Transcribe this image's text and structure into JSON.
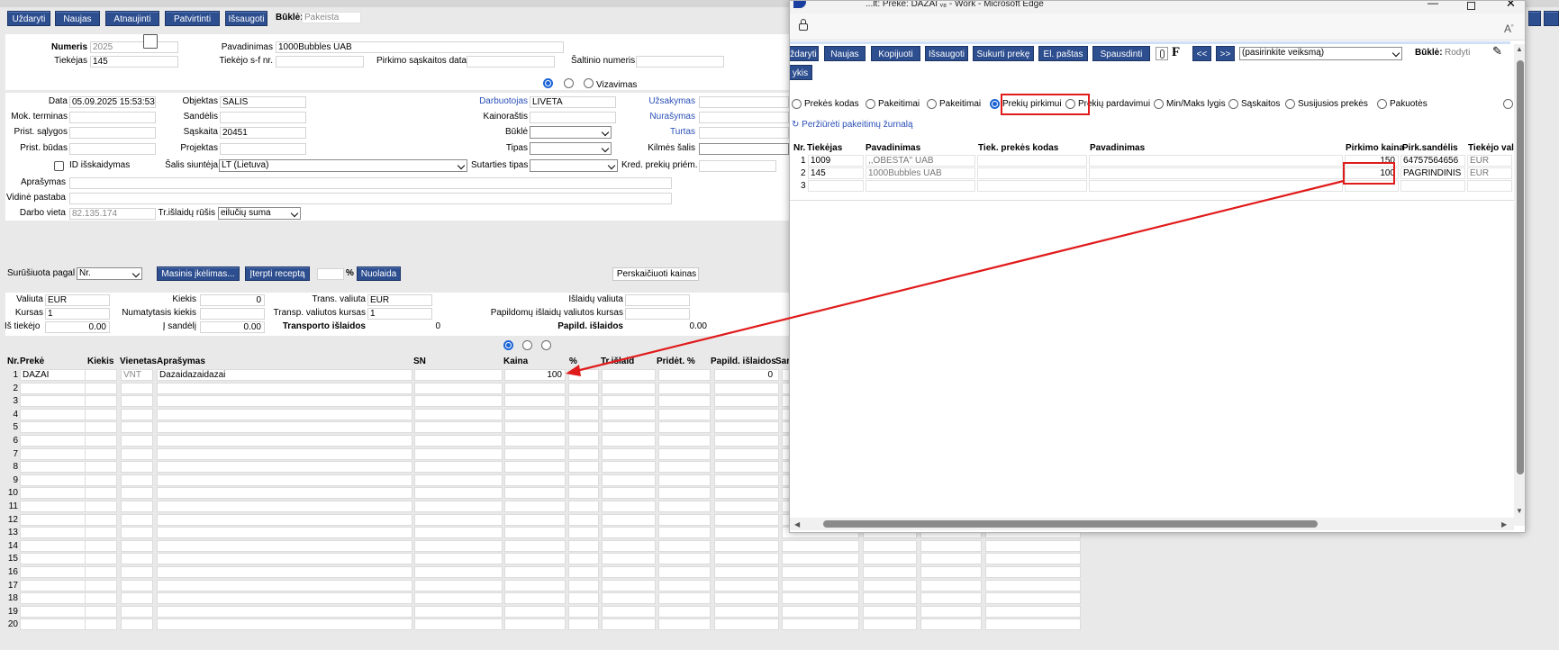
{
  "toolbar": {
    "buttons": [
      "Uždaryti",
      "Naujas",
      "Atnaujinti",
      "Patvirtinti",
      "Išsaugoti"
    ],
    "status_label": "Būklė:",
    "status_value": "Pakeista"
  },
  "header": {
    "numeris_label": "Numeris",
    "numeris": "2025",
    "tiekejas_label": "Tiekėjas",
    "tiekejas": "145",
    "pavadinimas_label": "Pavadinimas",
    "pavadinimas": "1000Bubbles UAB",
    "sf_label": "Tiekėjo s-f nr.",
    "pirkimo_label": "Pirkimo sąskaitos data",
    "saltinio_label": "Šaltinio numeris",
    "vizavimas_label": "Vizavimas"
  },
  "form": {
    "data_label": "Data",
    "data": "05.09.2025 15:53:53",
    "mok_label": "Mok. terminas",
    "prist_salygos_label": "Prist. sąlygos",
    "prist_budas_label": "Prist. būdas",
    "id_label": "ID išskaidymas",
    "objektas_label": "Objektas",
    "objektas": "ŠALIS",
    "sandelis_label": "Sandėlis",
    "saskaita_label": "Sąskaita",
    "saskaita": "20451",
    "projektas_label": "Projektas",
    "salis_label": "Šalis siuntėja",
    "salis": "LT (Lietuva)",
    "darbuotojas_label": "Darbuotojas",
    "darbuotojas": "LIVETA",
    "kainorastis_label": "Kainoraštis",
    "bukle_label": "Būklė",
    "tipas_label": "Tipas",
    "sutarties_label": "Sutarties tipas",
    "uzsakymas_label": "Užsakymas",
    "nurasymas_label": "Nurašymas",
    "turtas_label": "Turtas",
    "kilmes_label": "Kilmės šalis",
    "kred_label": "Kred. prekių priém.",
    "aprasymas_label": "Aprašymas",
    "vidine_label": "Vidinė pastaba",
    "darbo_label": "Darbo vieta",
    "darbo": "82.135.174",
    "trisl_label": "Tr.išlaidų rūšis",
    "trisl": "eilučių suma"
  },
  "sort": {
    "label": "Surūšiuota pagal",
    "value": "Nr.",
    "masinis": "Masinis įkėlimas...",
    "iterpti": "Įterpti receptą",
    "pct": "%",
    "nuolaida": "Nuolaida",
    "perskaiciuoti": "Perskaičiuoti kainas"
  },
  "totals": {
    "valiuta_label": "Valiuta",
    "valiuta": "EUR",
    "kursas_label": "Kursas",
    "kursas": "1",
    "is_tiekejo_label": "Iš tiekėjo",
    "is_tiekejo": "0.00",
    "kiekis_label": "Kiekis",
    "kiekis": "0",
    "numatytasis_label": "Numatytasis kiekis",
    "i_sandeli_label": "Į sandėlį",
    "i_sandeli": "0.00",
    "trans_val_label": "Trans. valiuta",
    "trans_val": "EUR",
    "transp_kursas_label": "Transp. valiutos kursas",
    "transp_kursas": "1",
    "transporto_label": "Transporto išlaidos",
    "transporto": "0",
    "islaidu_val_label": "Išlaidų valiuta",
    "papild_kursas_label": "Papildomų išlaidų valiutos kursas",
    "papild_label": "Papild. išlaidos",
    "papild": "0.00"
  },
  "grid": {
    "headers": [
      "Nr.",
      "Prekė",
      "Kiekis",
      "Vienetas",
      "Aprašymas",
      "SN",
      "Kaina",
      "%",
      "Tr.išlaid",
      "Pridėt. %",
      "Papild. išlaidos",
      "Sar"
    ],
    "row1": {
      "nr": "1",
      "preke": "DAZAI",
      "vienetas": "VNT",
      "aprasymas": "Dazaidazaidazai",
      "kaina": "100",
      "papild": "0"
    },
    "row_numbers": [
      "2",
      "3",
      "4",
      "5",
      "6",
      "7",
      "8",
      "9",
      "10",
      "11",
      "12",
      "13",
      "14",
      "15",
      "16",
      "17",
      "18",
      "19",
      "20"
    ]
  },
  "popup": {
    "title": "...lt: Prekė: DAZAI ᵥ₈ - Work - Microsoft Edge",
    "buttons": [
      "ždaryti",
      "Naujas",
      "Kopijuoti",
      "Išsaugoti",
      "Sukurti prekę",
      "El. paštas",
      "Spausdinti"
    ],
    "f_label": "F",
    "prev": "<<",
    "next": ">>",
    "action_select": "(pasirinkite veiksmą)",
    "status_label": "Būklė:",
    "status_value": "Rodyti",
    "second_row": "ykis",
    "tabs": [
      "Prekės kodas",
      "Pakeitimai",
      "Pakeitimai",
      "Prekių pirkimui",
      "Prekių pardavimui",
      "Min/Maks lygis",
      "Sąskaitos",
      "Susijusios prekės",
      "Pakuotės"
    ],
    "log_link": "Peržiūrėti pakeitimų žurnalą",
    "headers": [
      "Nr.",
      "Tiekėjas",
      "Pavadinimas",
      "Tiek. prekės kodas",
      "Pavadinimas",
      "Pirkimo kaina",
      "Pirk.sandėlis",
      "Tiekėjo val"
    ],
    "rows": [
      {
        "nr": "1",
        "tiekejas": "1009",
        "pavadinimas": ",,OBESTA'' UAB",
        "kaina": "150",
        "sandelis": "64757564656",
        "val": "EUR"
      },
      {
        "nr": "2",
        "tiekejas": "145",
        "pavadinimas": "1000Bubbles UAB",
        "kaina": "100",
        "sandelis": "PAGRINDINIS",
        "val": "EUR"
      },
      {
        "nr": "3",
        "tiekejas": "",
        "pavadinimas": "",
        "kaina": "",
        "sandelis": "",
        "val": ""
      }
    ]
  },
  "colors": {
    "button": "#2d4e8f",
    "accent_red": "#e01b1b",
    "link_blue": "#2a4fb8"
  }
}
